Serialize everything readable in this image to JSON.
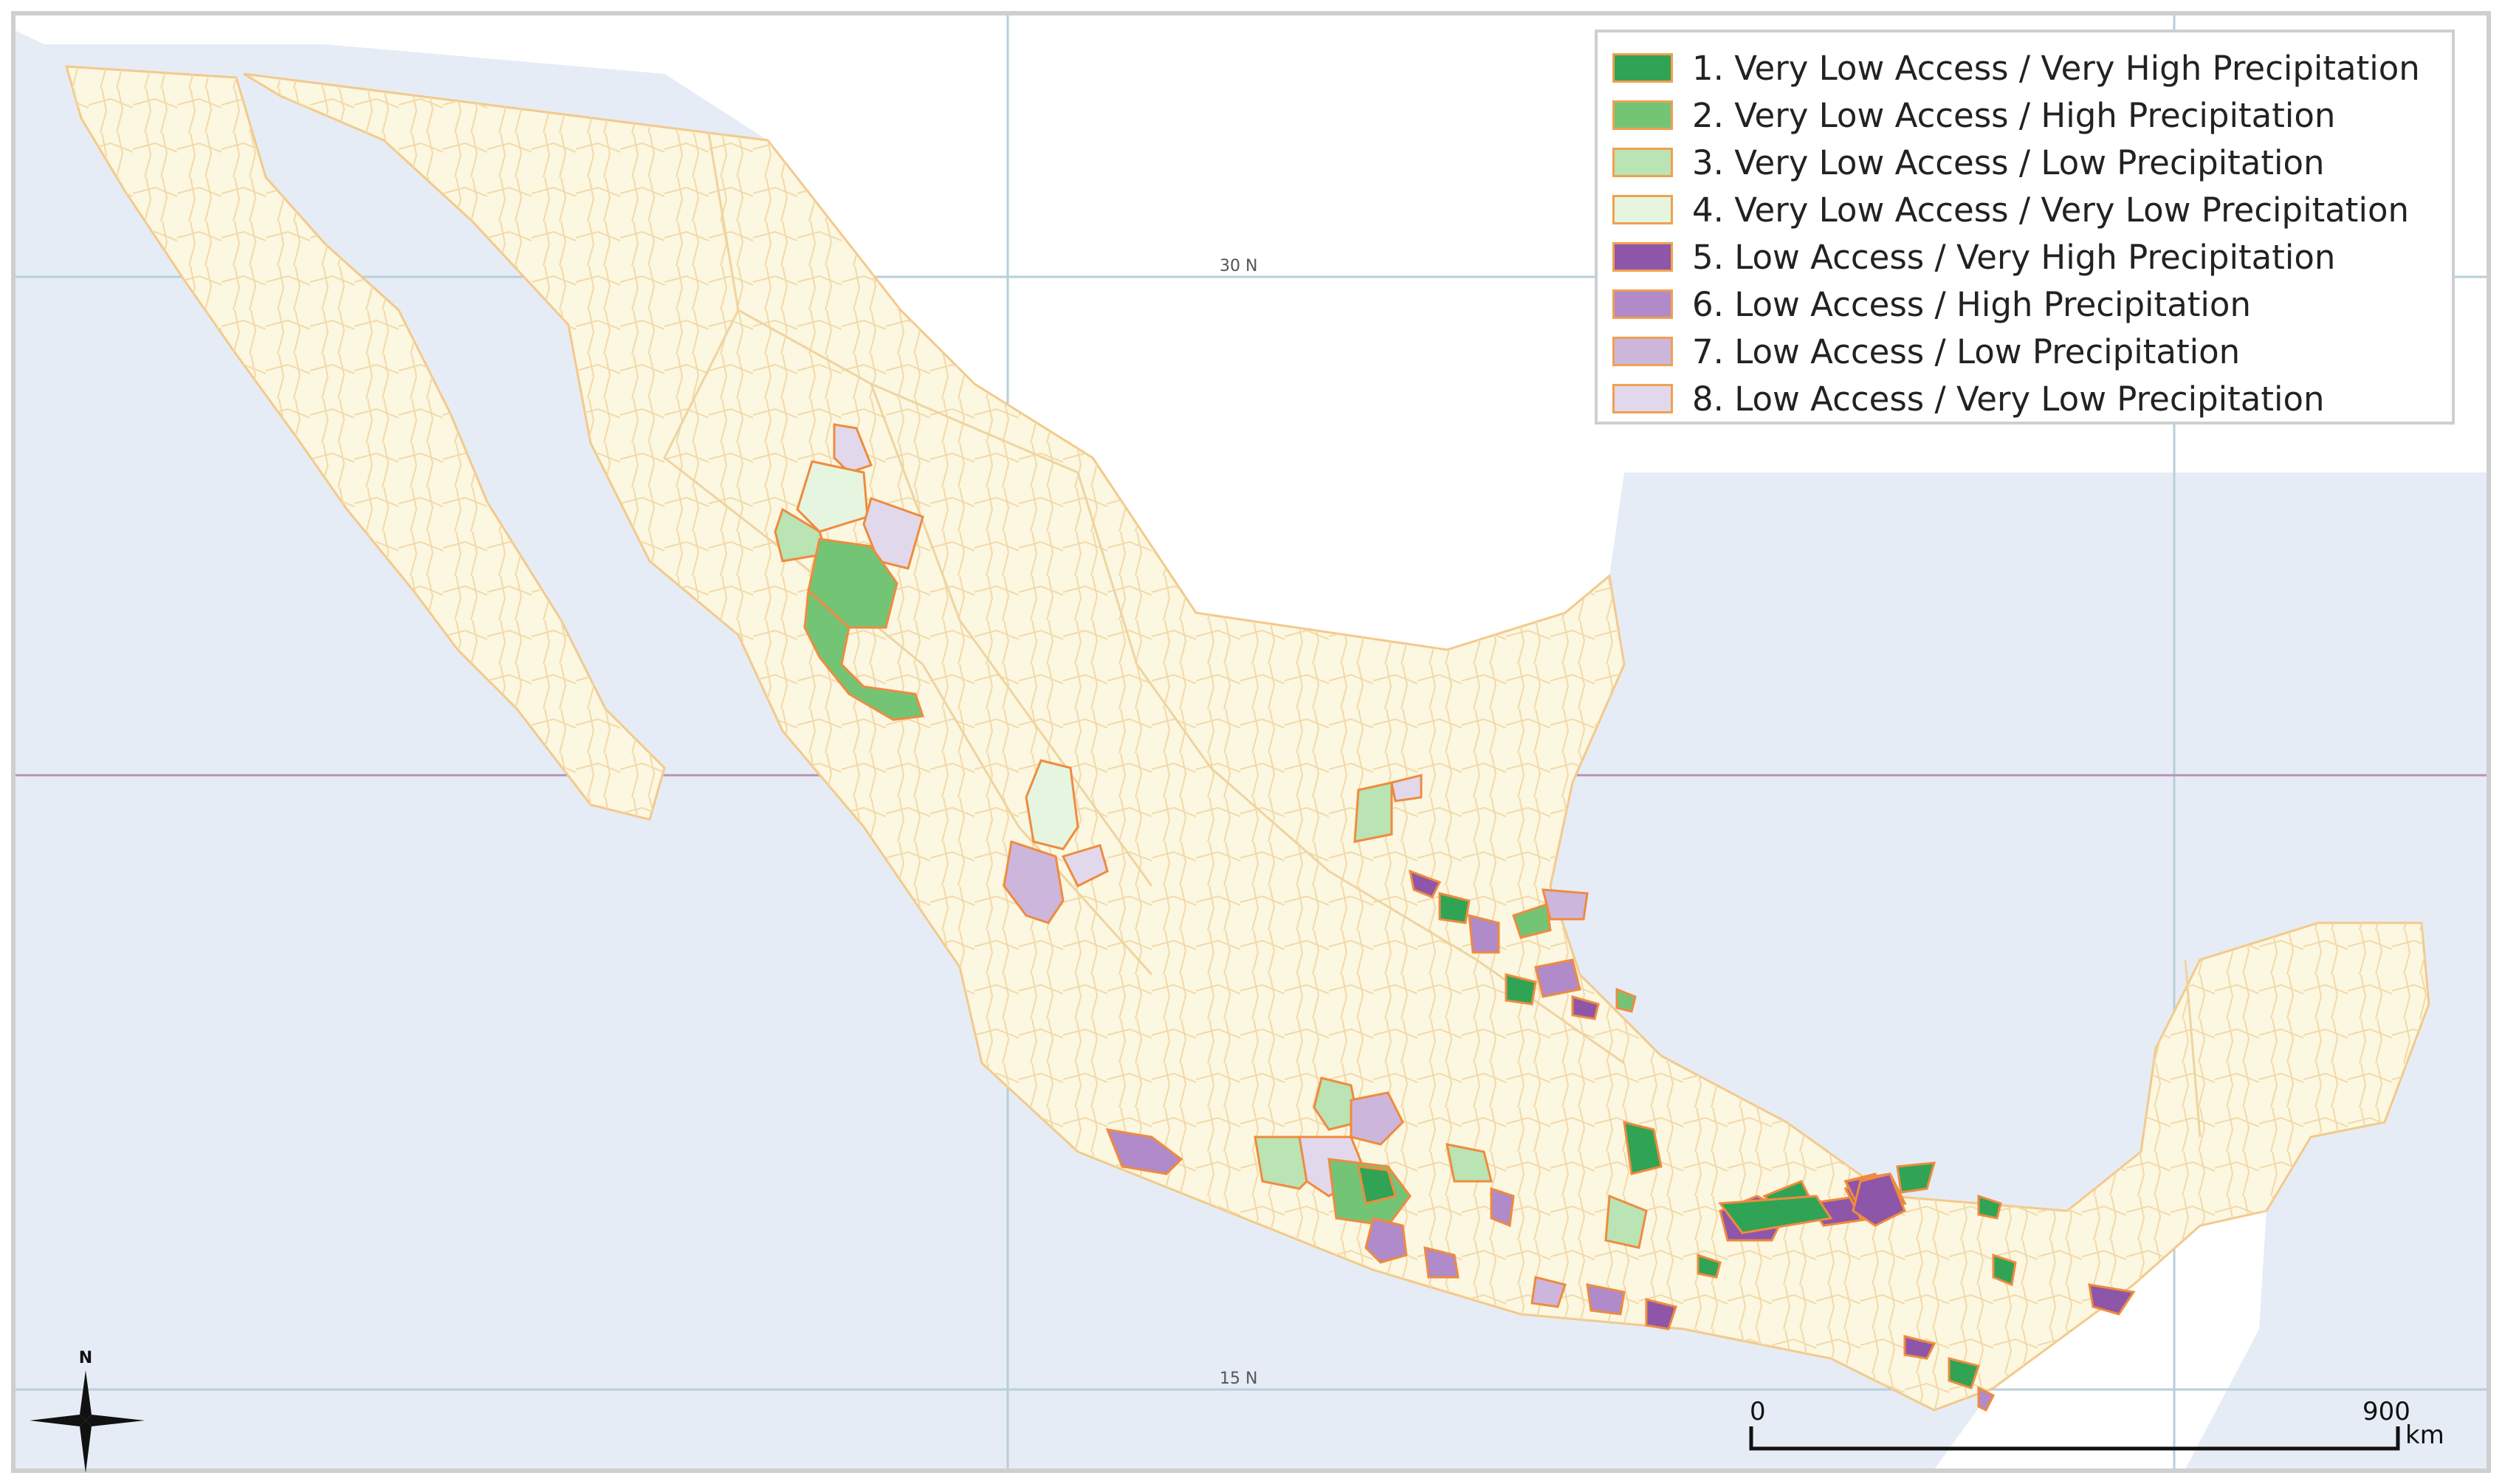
{
  "map": {
    "grid_labels": [
      "30 N",
      "15 N"
    ],
    "ocean_color": "#e6ecf5",
    "land_color": "#fbf7e1",
    "boundary_color": "#f3c98b"
  },
  "legend": {
    "items": [
      {
        "label": "1. Very Low Access / Very High Precipitation",
        "color": "#31a354"
      },
      {
        "label": "2. Very Low Access / High Precipitation",
        "color": "#74c476"
      },
      {
        "label": "3. Very Low Access / Low Precipitation",
        "color": "#bae4b3"
      },
      {
        "label": "4. Very Low Access / Very Low Precipitation",
        "color": "#e5f5e0"
      },
      {
        "label": "5. Low Access / Very High Precipitation",
        "color": "#8e56a8"
      },
      {
        "label": "6. Low Access / High Precipitation",
        "color": "#b08ac9"
      },
      {
        "label": "7. Low Access / Low Precipitation",
        "color": "#cdb6dc"
      },
      {
        "label": "8. Low Access / Very Low Precipitation",
        "color": "#e2d8ec"
      }
    ]
  },
  "scale_bar": {
    "start": "0",
    "end": "900",
    "unit": "km"
  },
  "north_arrow": {
    "label": "N"
  }
}
